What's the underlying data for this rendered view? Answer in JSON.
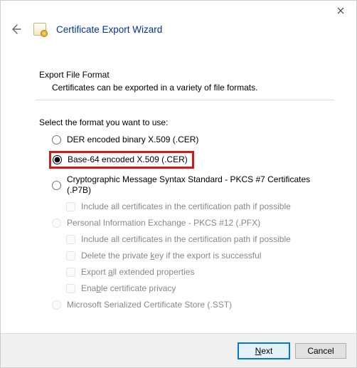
{
  "window": {
    "title": "Certificate Export Wizard"
  },
  "titlebar": {
    "close_label": "Close"
  },
  "page": {
    "section_title": "Export File Format",
    "section_desc": "Certificates can be exported in a variety of file formats.",
    "prompt": "Select the format you want to use:"
  },
  "options": {
    "der": {
      "label_pre": "DER encoded binary X.509 (.CER)",
      "selected": false,
      "enabled": true
    },
    "base64": {
      "label_pre": "Base-64 encoded X.509 (.CER)",
      "selected": true,
      "enabled": true
    },
    "pkcs7": {
      "label_pre": "Cryptographic Message Syntax Standard - PKCS #7 Certificates (.P7B)",
      "selected": false,
      "enabled": true,
      "include_chain": {
        "label": "Include all certificates in the certification path if possible",
        "checked": false,
        "enabled": false
      }
    },
    "pfx": {
      "label_pre": "Personal Information Exchange - PKCS #12 (.PFX)",
      "selected": false,
      "enabled": false,
      "include_chain": {
        "label": "Include all certificates in the certification path if possible",
        "checked": false,
        "enabled": false
      },
      "delete_key": {
        "label_pre": "Delete the private ",
        "accel": "k",
        "label_post": "ey if the export is successful",
        "checked": false,
        "enabled": false
      },
      "export_ext": {
        "label_pre": "Export ",
        "accel": "a",
        "label_post": "ll extended properties",
        "checked": false,
        "enabled": false
      },
      "cert_privacy": {
        "label_pre": "Ena",
        "accel": "b",
        "label_post": "le certificate privacy",
        "checked": false,
        "enabled": false
      }
    },
    "sst": {
      "label_pre": "Microsoft Serialized Certificate Store (.SST)",
      "selected": false,
      "enabled": false
    }
  },
  "footer": {
    "next": {
      "accel": "N",
      "post": "ext"
    },
    "cancel": "Cancel"
  }
}
